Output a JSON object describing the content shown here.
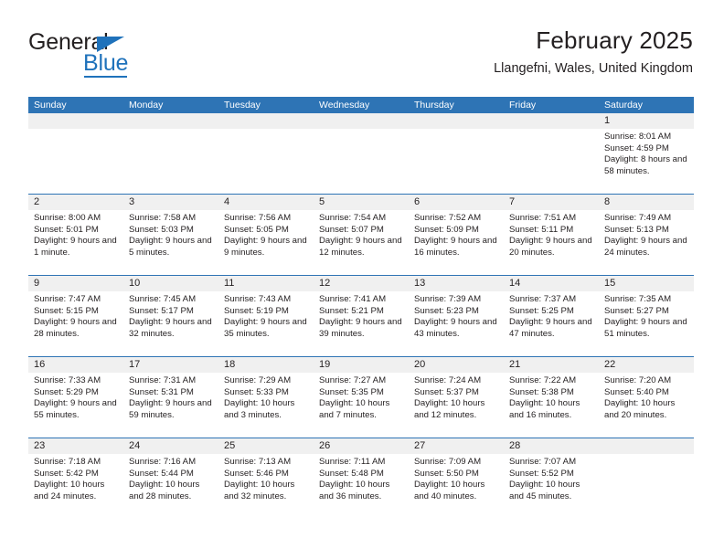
{
  "brand": {
    "name_top": "General",
    "name_bottom": "Blue",
    "accent_color": "#1f72bb"
  },
  "header": {
    "title": "February 2025",
    "subtitle": "Llangefni, Wales, United Kingdom",
    "header_blue": "#2e74b5"
  },
  "weekdays": [
    "Sunday",
    "Monday",
    "Tuesday",
    "Wednesday",
    "Thursday",
    "Friday",
    "Saturday"
  ],
  "labels": {
    "sunrise": "Sunrise:",
    "sunset": "Sunset:",
    "daylight": "Daylight:"
  },
  "weeks": [
    [
      {
        "day": "",
        "empty": true
      },
      {
        "day": "",
        "empty": true
      },
      {
        "day": "",
        "empty": true
      },
      {
        "day": "",
        "empty": true
      },
      {
        "day": "",
        "empty": true
      },
      {
        "day": "",
        "empty": true
      },
      {
        "day": "1",
        "sunrise": "Sunrise: 8:01 AM",
        "sunset": "Sunset: 4:59 PM",
        "daylight": "Daylight: 8 hours and 58 minutes."
      }
    ],
    [
      {
        "day": "2",
        "sunrise": "Sunrise: 8:00 AM",
        "sunset": "Sunset: 5:01 PM",
        "daylight": "Daylight: 9 hours and 1 minute."
      },
      {
        "day": "3",
        "sunrise": "Sunrise: 7:58 AM",
        "sunset": "Sunset: 5:03 PM",
        "daylight": "Daylight: 9 hours and 5 minutes."
      },
      {
        "day": "4",
        "sunrise": "Sunrise: 7:56 AM",
        "sunset": "Sunset: 5:05 PM",
        "daylight": "Daylight: 9 hours and 9 minutes."
      },
      {
        "day": "5",
        "sunrise": "Sunrise: 7:54 AM",
        "sunset": "Sunset: 5:07 PM",
        "daylight": "Daylight: 9 hours and 12 minutes."
      },
      {
        "day": "6",
        "sunrise": "Sunrise: 7:52 AM",
        "sunset": "Sunset: 5:09 PM",
        "daylight": "Daylight: 9 hours and 16 minutes."
      },
      {
        "day": "7",
        "sunrise": "Sunrise: 7:51 AM",
        "sunset": "Sunset: 5:11 PM",
        "daylight": "Daylight: 9 hours and 20 minutes."
      },
      {
        "day": "8",
        "sunrise": "Sunrise: 7:49 AM",
        "sunset": "Sunset: 5:13 PM",
        "daylight": "Daylight: 9 hours and 24 minutes."
      }
    ],
    [
      {
        "day": "9",
        "sunrise": "Sunrise: 7:47 AM",
        "sunset": "Sunset: 5:15 PM",
        "daylight": "Daylight: 9 hours and 28 minutes."
      },
      {
        "day": "10",
        "sunrise": "Sunrise: 7:45 AM",
        "sunset": "Sunset: 5:17 PM",
        "daylight": "Daylight: 9 hours and 32 minutes."
      },
      {
        "day": "11",
        "sunrise": "Sunrise: 7:43 AM",
        "sunset": "Sunset: 5:19 PM",
        "daylight": "Daylight: 9 hours and 35 minutes."
      },
      {
        "day": "12",
        "sunrise": "Sunrise: 7:41 AM",
        "sunset": "Sunset: 5:21 PM",
        "daylight": "Daylight: 9 hours and 39 minutes."
      },
      {
        "day": "13",
        "sunrise": "Sunrise: 7:39 AM",
        "sunset": "Sunset: 5:23 PM",
        "daylight": "Daylight: 9 hours and 43 minutes."
      },
      {
        "day": "14",
        "sunrise": "Sunrise: 7:37 AM",
        "sunset": "Sunset: 5:25 PM",
        "daylight": "Daylight: 9 hours and 47 minutes."
      },
      {
        "day": "15",
        "sunrise": "Sunrise: 7:35 AM",
        "sunset": "Sunset: 5:27 PM",
        "daylight": "Daylight: 9 hours and 51 minutes."
      }
    ],
    [
      {
        "day": "16",
        "sunrise": "Sunrise: 7:33 AM",
        "sunset": "Sunset: 5:29 PM",
        "daylight": "Daylight: 9 hours and 55 minutes."
      },
      {
        "day": "17",
        "sunrise": "Sunrise: 7:31 AM",
        "sunset": "Sunset: 5:31 PM",
        "daylight": "Daylight: 9 hours and 59 minutes."
      },
      {
        "day": "18",
        "sunrise": "Sunrise: 7:29 AM",
        "sunset": "Sunset: 5:33 PM",
        "daylight": "Daylight: 10 hours and 3 minutes."
      },
      {
        "day": "19",
        "sunrise": "Sunrise: 7:27 AM",
        "sunset": "Sunset: 5:35 PM",
        "daylight": "Daylight: 10 hours and 7 minutes."
      },
      {
        "day": "20",
        "sunrise": "Sunrise: 7:24 AM",
        "sunset": "Sunset: 5:37 PM",
        "daylight": "Daylight: 10 hours and 12 minutes."
      },
      {
        "day": "21",
        "sunrise": "Sunrise: 7:22 AM",
        "sunset": "Sunset: 5:38 PM",
        "daylight": "Daylight: 10 hours and 16 minutes."
      },
      {
        "day": "22",
        "sunrise": "Sunrise: 7:20 AM",
        "sunset": "Sunset: 5:40 PM",
        "daylight": "Daylight: 10 hours and 20 minutes."
      }
    ],
    [
      {
        "day": "23",
        "sunrise": "Sunrise: 7:18 AM",
        "sunset": "Sunset: 5:42 PM",
        "daylight": "Daylight: 10 hours and 24 minutes."
      },
      {
        "day": "24",
        "sunrise": "Sunrise: 7:16 AM",
        "sunset": "Sunset: 5:44 PM",
        "daylight": "Daylight: 10 hours and 28 minutes."
      },
      {
        "day": "25",
        "sunrise": "Sunrise: 7:13 AM",
        "sunset": "Sunset: 5:46 PM",
        "daylight": "Daylight: 10 hours and 32 minutes."
      },
      {
        "day": "26",
        "sunrise": "Sunrise: 7:11 AM",
        "sunset": "Sunset: 5:48 PM",
        "daylight": "Daylight: 10 hours and 36 minutes."
      },
      {
        "day": "27",
        "sunrise": "Sunrise: 7:09 AM",
        "sunset": "Sunset: 5:50 PM",
        "daylight": "Daylight: 10 hours and 40 minutes."
      },
      {
        "day": "28",
        "sunrise": "Sunrise: 7:07 AM",
        "sunset": "Sunset: 5:52 PM",
        "daylight": "Daylight: 10 hours and 45 minutes."
      },
      {
        "day": "",
        "empty": true
      }
    ]
  ]
}
